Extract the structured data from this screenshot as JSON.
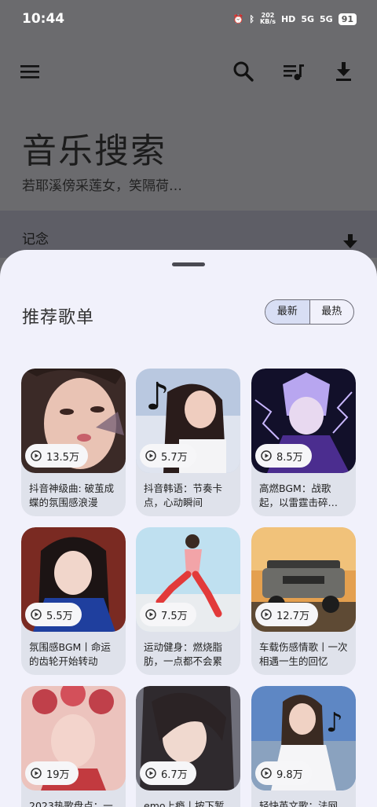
{
  "status": {
    "time": "10:44",
    "net_speed_value": "202",
    "net_speed_unit": "KB/s",
    "hd": "HD",
    "sim1": "5G",
    "sim2": "5G",
    "battery": "91"
  },
  "header": {
    "title": "音乐搜索",
    "subtitle": "若耶溪傍采莲女，笑隔荷…",
    "icons": [
      "menu-icon",
      "search-icon",
      "playlist-icon",
      "download-icon"
    ]
  },
  "strip": {
    "label": "记念"
  },
  "sheet": {
    "title": "推荐歌单",
    "tabs": [
      {
        "label": "最新",
        "active": true
      },
      {
        "label": "最热",
        "active": false
      }
    ]
  },
  "playlists": [
    {
      "count": "13.5万",
      "caption": "抖音神级曲: 破茧成蝶的氛围感浪漫"
    },
    {
      "count": "5.7万",
      "caption": "抖音韩语：节奏卡点，心动瞬间"
    },
    {
      "count": "8.5万",
      "caption": "高燃BGM：战歌起，以雷霆击碎…"
    },
    {
      "count": "5.5万",
      "caption": "氛围感BGM丨命运的齿轮开始转动"
    },
    {
      "count": "7.5万",
      "caption": "运动健身：燃烧脂肪，一点都不会累"
    },
    {
      "count": "12.7万",
      "caption": "车载伤感情歌丨一次相遇一生的回忆"
    },
    {
      "count": "19万",
      "caption": "2023热歌盘点：一"
    },
    {
      "count": "6.7万",
      "caption": "emo上瘾丨按下暂"
    },
    {
      "count": "9.8万",
      "caption": "轻快英文歌：法网"
    }
  ]
}
